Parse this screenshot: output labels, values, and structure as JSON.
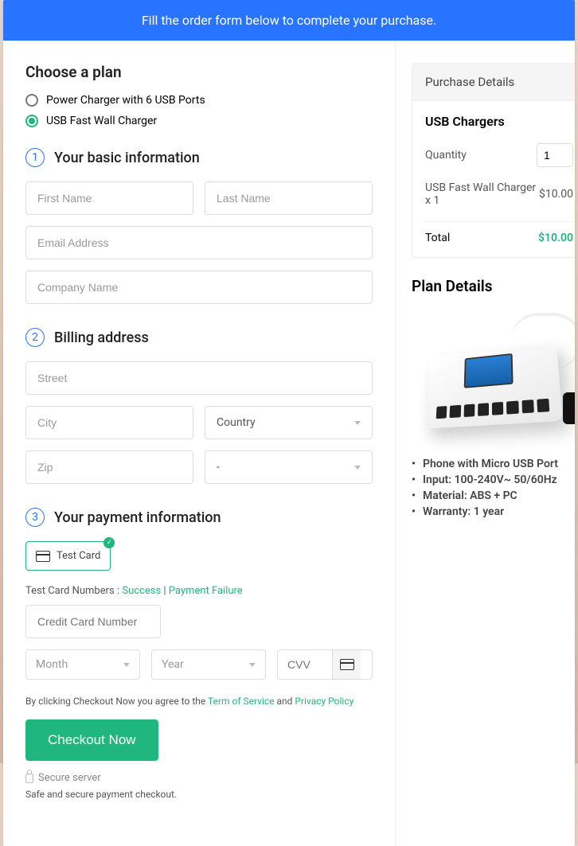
{
  "banner": "Fill the order form below to complete your purchase.",
  "plan": {
    "heading": "Choose a plan",
    "options": [
      "Power Charger with 6 USB Ports",
      "USB Fast Wall Charger"
    ]
  },
  "step1": {
    "num": "1",
    "title": "Your basic information",
    "first": "First Name",
    "last": "Last Name",
    "email": "Email Address",
    "company": "Company Name"
  },
  "step2": {
    "num": "2",
    "title": "Billing address",
    "street": "Street",
    "city": "City",
    "country": "Country",
    "zip": "Zip",
    "dash": "-"
  },
  "step3": {
    "num": "3",
    "title": "Your payment information",
    "card_label": "Test  Card",
    "test_prefix": "Test Card Numbers :",
    "success": "Success",
    "failure": "Payment Failure",
    "cc": "Credit Card Number",
    "month": "Month",
    "year": "Year",
    "cvv": "CVV"
  },
  "agree": {
    "pre": "By clicking Checkout Now you agree to the ",
    "tos": "Term of Service",
    "and": " and ",
    "pp": "Privacy Policy"
  },
  "checkout": "Checkout Now",
  "secure": "Secure server",
  "safe": "Safe and secure payment checkout.",
  "purchase": {
    "heading": "Purchase Details",
    "title": "USB Chargers",
    "qty_label": "Quantity",
    "qty": "1",
    "line_item": "USB Fast Wall Charger x 1",
    "line_price": "$10.00",
    "total_label": "Total",
    "total": "$10.00"
  },
  "planDetails": {
    "heading": "Plan Details",
    "features": [
      "Phone with Micro USB Port",
      "Input: 100-240V~ 50/60Hz",
      "Material: ABS + PC",
      "Warranty: 1 year"
    ]
  }
}
